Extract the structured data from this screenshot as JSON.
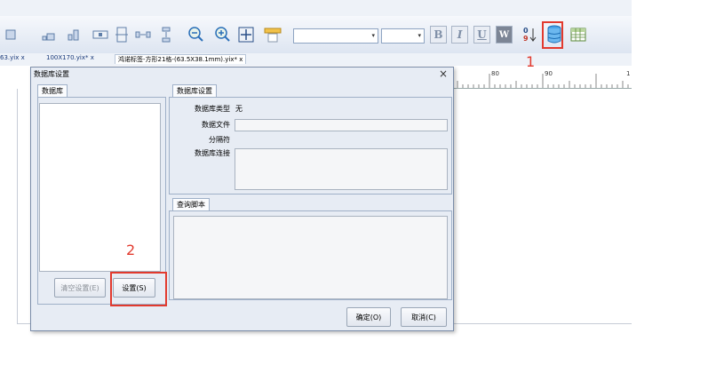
{
  "toolbar": {
    "buttons": [
      "align-icon",
      "align-right-icon",
      "bar-chart-icon",
      "distribute-horizontal-icon",
      "distribute-vertical-icon",
      "space-horizontal-icon",
      "space-vertical-icon",
      "zoom-out-icon",
      "zoom-in-icon",
      "fit-page-icon",
      "ruler-icon",
      "bold-icon",
      "italic-icon",
      "underline-icon",
      "word-wrap-icon",
      "sort-icon",
      "database-icon",
      "table-icon"
    ],
    "bold_label": "B",
    "italic_label": "I",
    "underline_label": "U",
    "wrap_label": "W",
    "sort_label": "0/9"
  },
  "doc_tabs": [
    {
      "label": "63.yix x"
    },
    {
      "label": "100X170.yix* x"
    },
    {
      "label": "鸿诺标签-方形21格-(63.5X38.1mm).yix* x"
    }
  ],
  "ruler": {
    "labels": [
      "80",
      "90",
      "1"
    ]
  },
  "annotations": {
    "marker1": "1",
    "marker2": "2"
  },
  "dialog": {
    "title": "数据库设置",
    "close_label": "×",
    "left_group": "数据库",
    "settings_group": "数据库设置",
    "db_type_label": "数据库类型",
    "db_type_value": "无",
    "data_file_label": "数据文件",
    "separator_label": "分隔符",
    "connection_label": "数据库连接",
    "query_group": "查询脚本",
    "clear_button": "清空设置(E)",
    "settings_button": "设置(S)",
    "ok_button": "确定(O)",
    "cancel_button": "取消(C)"
  },
  "colors": {
    "accent_red": "#e23a2e",
    "dialog_bg": "#e7ecf4",
    "toolbar_bg": "#dde5f1"
  }
}
